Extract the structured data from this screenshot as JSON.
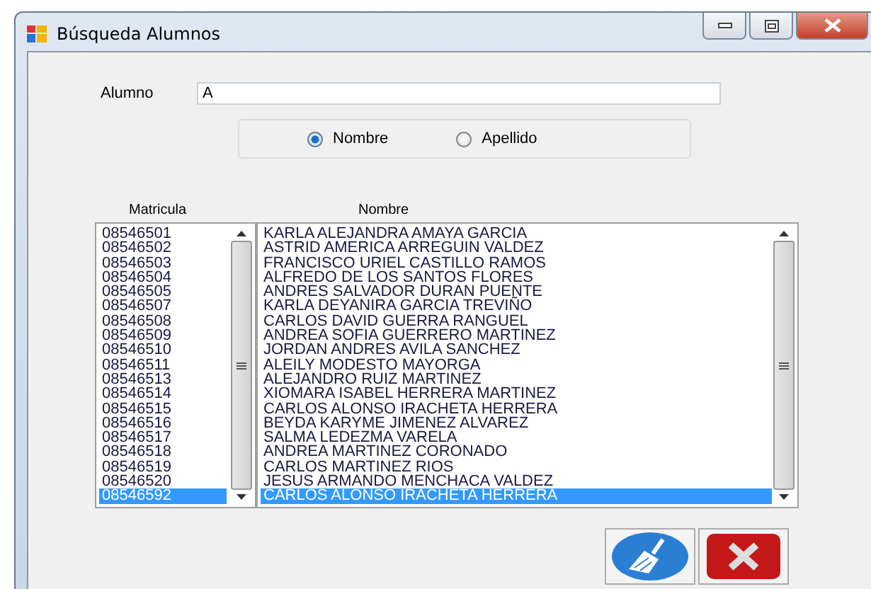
{
  "window": {
    "title": "Búsqueda Alumnos"
  },
  "search": {
    "label": "Alumno",
    "value": "A"
  },
  "search_by": [
    {
      "label": "Nombre",
      "selected": true
    },
    {
      "label": "Apellido",
      "selected": false
    }
  ],
  "lists": {
    "matricula_header": "Matricula",
    "nombre_header": "Nombre",
    "matriculas": [
      {
        "text": "08546501",
        "selected": false
      },
      {
        "text": "08546502",
        "selected": false
      },
      {
        "text": "08546503",
        "selected": false
      },
      {
        "text": "08546504",
        "selected": false
      },
      {
        "text": "08546505",
        "selected": false
      },
      {
        "text": "08546507",
        "selected": false
      },
      {
        "text": "08546508",
        "selected": false
      },
      {
        "text": "08546509",
        "selected": false
      },
      {
        "text": "08546510",
        "selected": false
      },
      {
        "text": "08546511",
        "selected": false
      },
      {
        "text": "08546513",
        "selected": false
      },
      {
        "text": "08546514",
        "selected": false
      },
      {
        "text": "08546515",
        "selected": false
      },
      {
        "text": "08546516",
        "selected": false
      },
      {
        "text": "08546517",
        "selected": false
      },
      {
        "text": "08546518",
        "selected": false
      },
      {
        "text": "08546519",
        "selected": false
      },
      {
        "text": "08546520",
        "selected": false
      },
      {
        "text": "08546592",
        "selected": true
      }
    ],
    "nombres": [
      {
        "text": "KARLA ALEJANDRA AMAYA GARCIA",
        "selected": false
      },
      {
        "text": "ASTRID AMERICA ARREGUIN VALDEZ",
        "selected": false
      },
      {
        "text": "FRANCISCO URIEL CASTILLO RAMOS",
        "selected": false
      },
      {
        "text": "ALFREDO DE LOS SANTOS FLORES",
        "selected": false
      },
      {
        "text": "ANDRES SALVADOR DURAN PUENTE",
        "selected": false
      },
      {
        "text": "KARLA DEYANIRA GARCIA TREVIÑO",
        "selected": false
      },
      {
        "text": "CARLOS DAVID  GUERRA RANGUEL",
        "selected": false
      },
      {
        "text": "ANDREA SOFIA GUERRERO MARTINEZ",
        "selected": false
      },
      {
        "text": "JORDAN ANDRES AVILA SANCHEZ",
        "selected": false
      },
      {
        "text": "ALEILY MODESTO MAYORGA",
        "selected": false
      },
      {
        "text": "ALEJANDRO RUIZ MARTINEZ",
        "selected": false
      },
      {
        "text": "XIOMARA ISABEL HERRERA MARTINEZ",
        "selected": false
      },
      {
        "text": "CARLOS ALONSO IRACHETA HERRERA",
        "selected": false
      },
      {
        "text": "BEYDA KARYME JIMENEZ ALVAREZ",
        "selected": false
      },
      {
        "text": "SALMA LEDEZMA VARELA",
        "selected": false
      },
      {
        "text": "ANDREA MARTINEZ  CORONADO",
        "selected": false
      },
      {
        "text": "CARLOS MARTINEZ RIOS",
        "selected": false
      },
      {
        "text": "JESUS ARMANDO MENCHACA VALDEZ",
        "selected": false
      },
      {
        "text": "CARLOS ALONSO IRACHETA HERRERA",
        "selected": true
      }
    ]
  }
}
